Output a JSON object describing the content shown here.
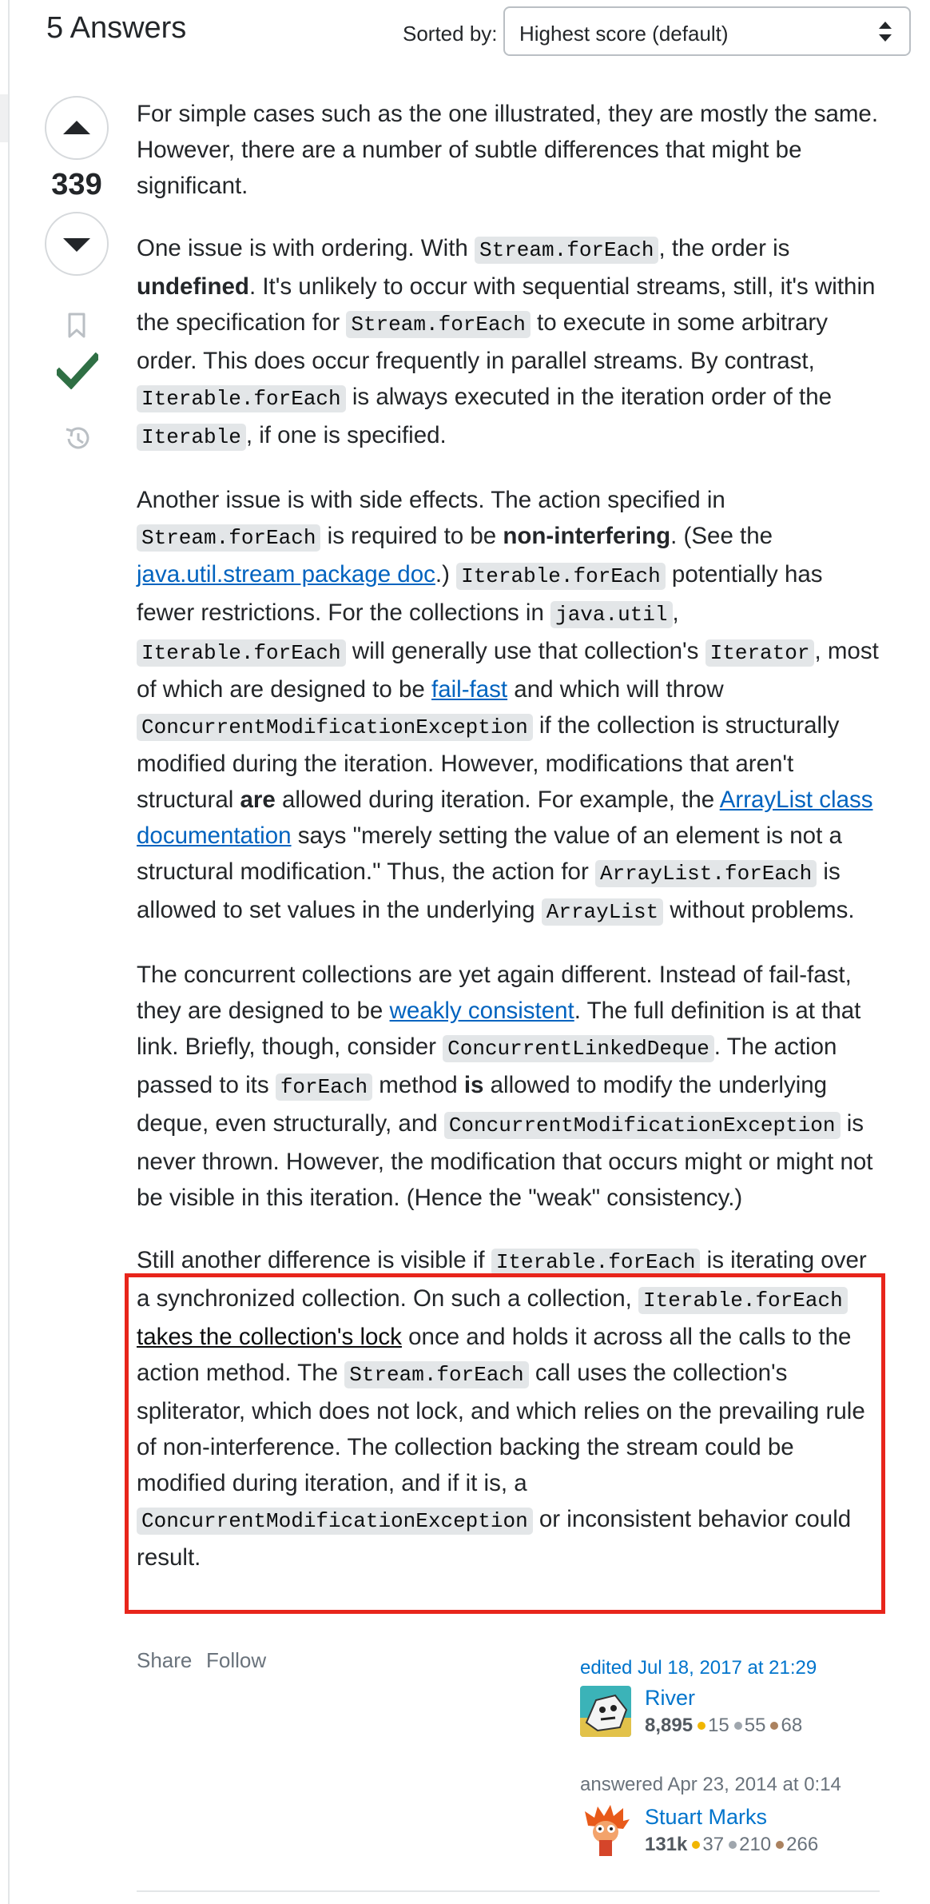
{
  "header": {
    "answers_count": "5 Answers",
    "sorted_label": "Sorted by:",
    "sort_value": "Highest score (default)"
  },
  "votes": {
    "score": "339"
  },
  "post": {
    "p1": "For simple cases such as the one illustrated, they are mostly the same. However, there are a number of subtle differences that might be significant.",
    "p2": {
      "t1": "One issue is with ordering. With ",
      "c1": "Stream.forEach",
      "t2": ", the order is ",
      "b1": "undefined",
      "t3": ". It's unlikely to occur with sequential streams, still, it's within the specification for ",
      "c2": "Stream.forEach",
      "t4": " to execute in some arbitrary order. This does occur frequently in parallel streams. By contrast, ",
      "c3": "Iterable.forEach",
      "t5": " is always executed in the iteration order of the ",
      "c4": "Iterable",
      "t6": ", if one is specified."
    },
    "p3": {
      "t1": "Another issue is with side effects. The action specified in ",
      "c1": "Stream.forEach",
      "t2": " is required to be ",
      "b1": "non-interfering",
      "t3": ". (See the ",
      "l1": "java.util.stream package doc",
      "t4": ".) ",
      "c2": "Iterable.forEach",
      "t5": " potentially has fewer restrictions. For the collections in ",
      "c3": "java.util",
      "t6": ", ",
      "c4": "Iterable.forEach",
      "t7": " will generally use that collection's ",
      "c5": "Iterator",
      "t8": ", most of which are designed to be ",
      "l2": "fail-fast",
      "t9": " and which will throw ",
      "c6": "ConcurrentModificationException",
      "t10": " if the collection is structurally modified during the iteration. However, modifications that aren't structural ",
      "b2": "are",
      "t11": " allowed during iteration. For example, the ",
      "l3": "ArrayList class documentation",
      "t12": " says \"merely setting the value of an element is not a structural modification.\" Thus, the action for ",
      "c7": "ArrayList.forEach",
      "t13": " is allowed to set values in the underlying ",
      "c8": "ArrayList",
      "t14": " without problems."
    },
    "p4": {
      "t1": "The concurrent collections are yet again different. Instead of fail-fast, they are designed to be ",
      "l1": "weakly consistent",
      "t2": ". The full definition is at that link. Briefly, though, consider ",
      "c1": "ConcurrentLinkedDeque",
      "t3": ". The action passed to its ",
      "c2": "forEach",
      "t4": " method ",
      "b1": "is",
      "t5": " allowed to modify the underlying deque, even structurally, and ",
      "c3": "ConcurrentModificationException",
      "t6": " is never thrown. However, the modification that occurs might or might not be visible in this iteration. (Hence the \"weak\" consistency.)"
    },
    "p5": {
      "t1": "Still another difference is visible if ",
      "c1": "Iterable.forEach",
      "t2": " is iterating over a synchronized collection. On such a collection, ",
      "c2": "Iterable.forEach",
      "t3": " ",
      "l1": "takes the collection's lock",
      "t4": " once and holds it across all the calls to the action method. The ",
      "c3": "Stream.forEach",
      "t5": " call uses the collection's spliterator, which does not lock, and which relies on the prevailing rule of non-interference. The collection backing the stream could be modified during iteration, and if it is, a ",
      "c4": "ConcurrentModificationException",
      "t6": " or inconsistent behavior could result."
    }
  },
  "footer": {
    "share": "Share",
    "follow": "Follow",
    "edited": "edited Jul 18, 2017 at 21:29",
    "editor": {
      "name": "River",
      "rep": "8,895",
      "gold": "15",
      "silver": "55",
      "bronze": "68"
    },
    "answered": "answered Apr 23, 2014 at 0:14",
    "author": {
      "name": "Stuart Marks",
      "rep": "131k",
      "gold": "37",
      "silver": "210",
      "bronze": "266"
    }
  },
  "colors": {
    "link": "#0063bf",
    "accepted": "#2f6f44",
    "highlight_border": "#e8251b",
    "code_bg": "#e3e6e8"
  },
  "icons": [
    "upvote-icon",
    "downvote-icon",
    "bookmark-icon",
    "accepted-check-icon",
    "history-icon",
    "sort-arrows-icon"
  ]
}
